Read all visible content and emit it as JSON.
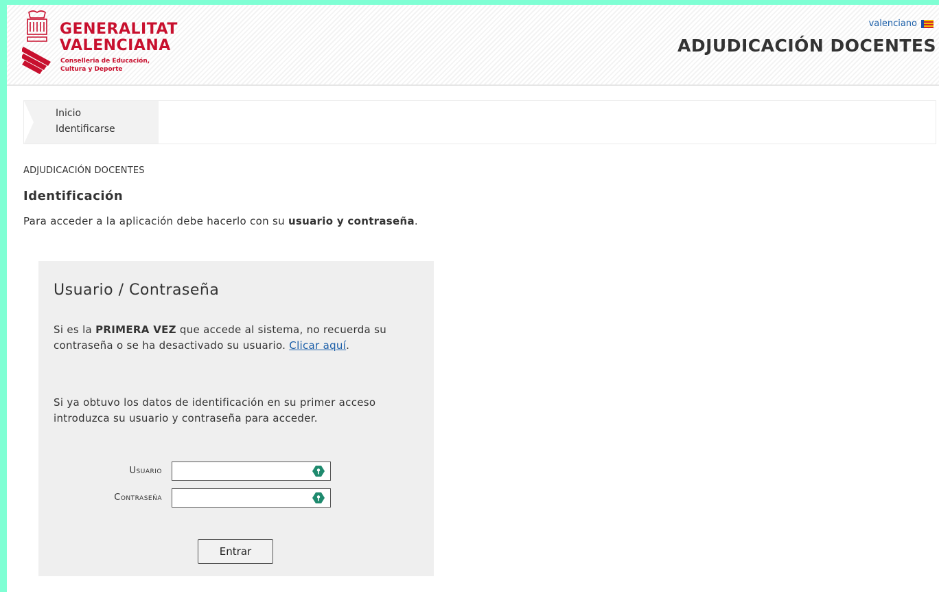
{
  "header": {
    "logo_line1": "GENERALITAT",
    "logo_line2": "VALENCIANA",
    "logo_sub1": "Conselleria de Educación,",
    "logo_sub2": "Cultura y Deporte",
    "language_link": "valenciano",
    "app_title": "ADJUDICACIÓN DOCENTES"
  },
  "breadcrumb": {
    "items": [
      "Inicio",
      "Identificarse"
    ]
  },
  "section_label": "ADJUDICACIÓN DOCENTES",
  "page_title": "Identificación",
  "intro": {
    "prefix": "Para acceder a la aplicación debe hacerlo con su ",
    "bold": "usuario y contraseña",
    "suffix": "."
  },
  "panel": {
    "title": "Usuario / Contraseña",
    "p1_prefix": "Si es la ",
    "p1_bold": "PRIMERA VEZ",
    "p1_middle": " que accede al sistema, no recuerda su contraseña o se ha desactivado su usuario. ",
    "p1_link": "Clicar aquí",
    "p1_suffix": ".",
    "p2": "Si ya obtuvo los datos de identificación en su primer acceso introduzca su usuario y contraseña para acceder.",
    "user_label": "Usuario",
    "pass_label": "Contraseña",
    "user_value": "",
    "pass_value": "",
    "submit_label": "Entrar"
  },
  "colors": {
    "outer_background": "#7fffd4",
    "brand_red": "#c8102e",
    "link_blue": "#1a5ea8",
    "panel_bg": "#efefef",
    "key_icon": "#1f8a6e"
  },
  "icons": [
    "emblem-icon",
    "flag-icon",
    "key-icon"
  ]
}
